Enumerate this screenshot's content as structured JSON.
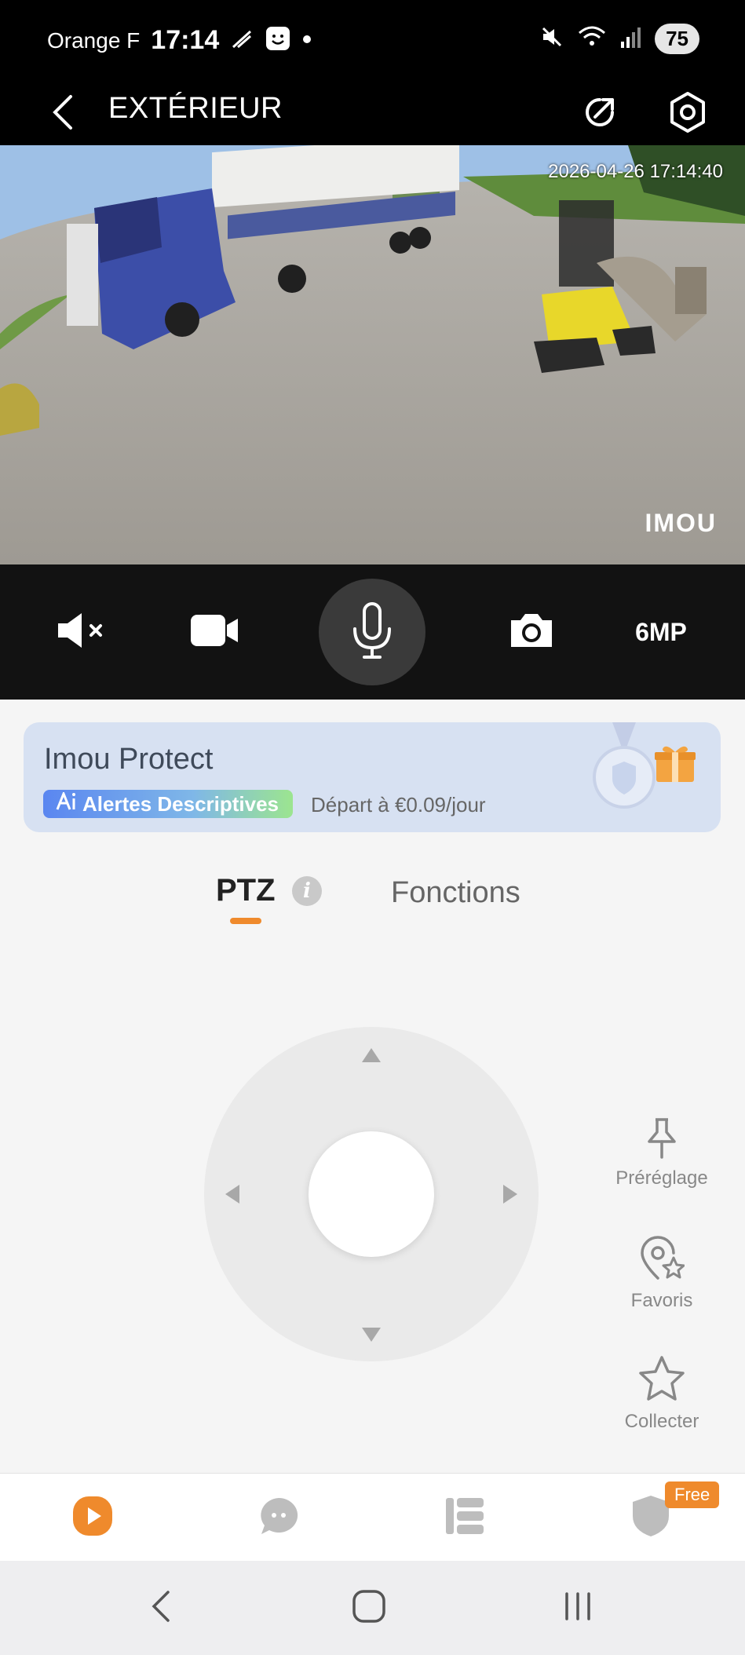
{
  "status_bar": {
    "carrier": "Orange F",
    "time": "17:14",
    "battery": "75"
  },
  "header": {
    "title": "EXTÉRIEUR"
  },
  "video": {
    "timestamp": "2026-04-26 17:14:40",
    "logo": "IMOU"
  },
  "controls": {
    "resolution_label": "6MP"
  },
  "promo": {
    "title": "Imou Protect",
    "badge_label": "Alertes Descriptives",
    "price_text": "Départ à €0.09/jour"
  },
  "tabs": {
    "ptz": "PTZ",
    "functions": "Fonctions"
  },
  "side_actions": {
    "preset": "Préréglage",
    "favorites": "Favoris",
    "collect": "Collecter"
  },
  "bottom_nav": {
    "free_badge": "Free"
  },
  "colors": {
    "accent": "#ef8a2c",
    "promo_bg": "#d7e1f2",
    "header_bg": "#000000"
  },
  "icons": [
    "back-icon",
    "share-icon",
    "settings-icon",
    "mute-icon",
    "record-icon",
    "mic-icon",
    "snapshot-icon",
    "info-icon",
    "pin-icon",
    "favorite-location-icon",
    "star-icon",
    "play-icon",
    "chat-icon",
    "list-icon",
    "shield-icon"
  ]
}
